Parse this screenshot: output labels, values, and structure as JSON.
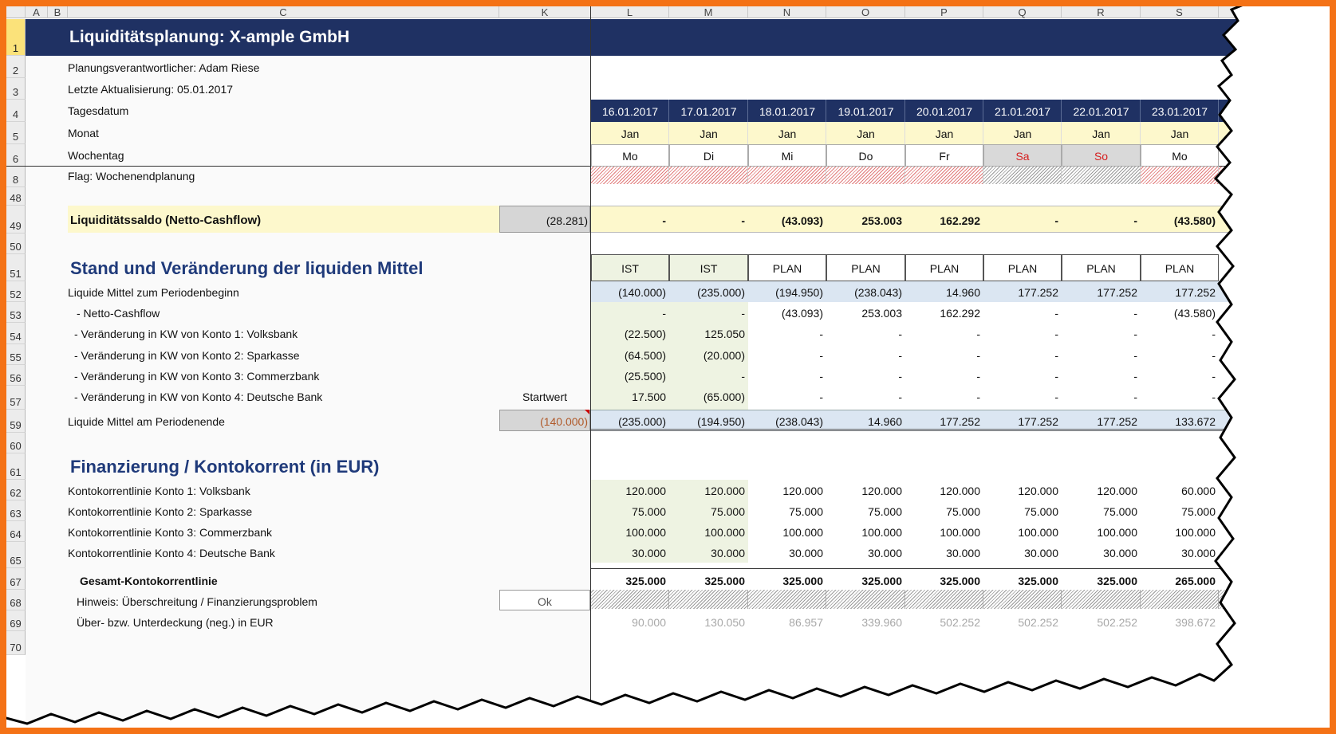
{
  "columns": [
    "A",
    "B",
    "C",
    "K",
    "L",
    "M",
    "N",
    "O",
    "P",
    "Q",
    "R",
    "S"
  ],
  "rows": [
    "1",
    "2",
    "3",
    "4",
    "5",
    "6",
    "8",
    "48",
    "49",
    "50",
    "51",
    "52",
    "53",
    "54",
    "55",
    "56",
    "57",
    "59",
    "60",
    "61",
    "62",
    "63",
    "64",
    "65",
    "67",
    "68",
    "69",
    "70"
  ],
  "title": "Liquiditätsplanung: X-ample GmbH",
  "responsible": "Planungsverantwortlicher: Adam Riese",
  "updated": "Letzte Aktualisierung: 05.01.2017",
  "labels": {
    "date": "Tagesdatum",
    "month": "Monat",
    "weekday": "Wochentag",
    "flag": "Flag: Wochenendplanung"
  },
  "dates": [
    "16.01.2017",
    "17.01.2017",
    "18.01.2017",
    "19.01.2017",
    "20.01.2017",
    "21.01.2017",
    "22.01.2017",
    "23.01.2017"
  ],
  "months": [
    "Jan",
    "Jan",
    "Jan",
    "Jan",
    "Jan",
    "Jan",
    "Jan",
    "Jan"
  ],
  "weekdays": [
    "Mo",
    "Di",
    "Mi",
    "Do",
    "Fr",
    "Sa",
    "So",
    "Mo"
  ],
  "weekend_flags": [
    true,
    true,
    true,
    true,
    true,
    false,
    false,
    true
  ],
  "saldo": {
    "label": "Liquiditätssaldo (Netto-Cashflow)",
    "total": "(28.281)",
    "values": [
      "-",
      "-",
      "(43.093)",
      "253.003",
      "162.292",
      "-",
      "-",
      "(43.580)"
    ]
  },
  "section1": {
    "title": "Stand und Veränderung der liquiden Mittel",
    "status": [
      "IST",
      "IST",
      "PLAN",
      "PLAN",
      "PLAN",
      "PLAN",
      "PLAN",
      "PLAN"
    ]
  },
  "liquid_rows": [
    {
      "label": "Liquide Mittel zum Periodenbeginn",
      "values": [
        "(140.000)",
        "(235.000)",
        "(194.950)",
        "(238.043)",
        "14.960",
        "177.252",
        "177.252",
        "177.252"
      ]
    },
    {
      "label": "- Netto-Cashflow",
      "values": [
        "-",
        "-",
        "(43.093)",
        "253.003",
        "162.292",
        "-",
        "-",
        "(43.580)"
      ]
    },
    {
      "label": "- Veränderung in KW von Konto 1: Volksbank",
      "values": [
        "(22.500)",
        "125.050",
        "-",
        "-",
        "-",
        "-",
        "-",
        "-"
      ]
    },
    {
      "label": "- Veränderung in KW von Konto 2: Sparkasse",
      "values": [
        "(64.500)",
        "(20.000)",
        "-",
        "-",
        "-",
        "-",
        "-",
        "-"
      ]
    },
    {
      "label": "- Veränderung in KW von Konto 3: Commerzbank",
      "values": [
        "(25.500)",
        "-",
        "-",
        "-",
        "-",
        "-",
        "-",
        "-"
      ]
    },
    {
      "label": "- Veränderung in KW von Konto 4: Deutsche Bank",
      "values": [
        "17.500",
        "(65.000)",
        "-",
        "-",
        "-",
        "-",
        "-",
        "-"
      ]
    }
  ],
  "startwert_label": "Startwert",
  "end_row": {
    "label": "Liquide Mittel am Periodenende",
    "start": "(140.000)",
    "values": [
      "(235.000)",
      "(194.950)",
      "(238.043)",
      "14.960",
      "177.252",
      "177.252",
      "177.252",
      "133.672"
    ]
  },
  "section2": {
    "title": "Finanzierung / Kontokorrent (in EUR)"
  },
  "credit_rows": [
    {
      "label": "Kontokorrentlinie Konto 1: Volksbank",
      "values": [
        "120.000",
        "120.000",
        "120.000",
        "120.000",
        "120.000",
        "120.000",
        "120.000",
        "60.000"
      ]
    },
    {
      "label": "Kontokorrentlinie Konto 2: Sparkasse",
      "values": [
        "75.000",
        "75.000",
        "75.000",
        "75.000",
        "75.000",
        "75.000",
        "75.000",
        "75.000"
      ]
    },
    {
      "label": "Kontokorrentlinie Konto 3: Commerzbank",
      "values": [
        "100.000",
        "100.000",
        "100.000",
        "100.000",
        "100.000",
        "100.000",
        "100.000",
        "100.000"
      ]
    },
    {
      "label": "Kontokorrentlinie Konto 4: Deutsche Bank",
      "values": [
        "30.000",
        "30.000",
        "30.000",
        "30.000",
        "30.000",
        "30.000",
        "30.000",
        "30.000"
      ]
    }
  ],
  "total_credit": {
    "label": "Gesamt-Kontokorrentlinie",
    "values": [
      "325.000",
      "325.000",
      "325.000",
      "325.000",
      "325.000",
      "325.000",
      "325.000",
      "265.000"
    ]
  },
  "hint": {
    "label": "Hinweis:  Überschreitung / Finanzierungsproblem",
    "status": "Ok"
  },
  "coverage": {
    "label": "Über- bzw. Unterdeckung (neg.) in EUR",
    "values": [
      "90.000",
      "130.050",
      "86.957",
      "339.960",
      "502.252",
      "502.252",
      "502.252",
      "398.672"
    ]
  },
  "colors": {
    "header_blue": "#1f3163",
    "yellow": "#fdf8cc",
    "ist_green": "#eef3e2",
    "blue_row": "#dbe6f2",
    "frame": "#f47216"
  }
}
